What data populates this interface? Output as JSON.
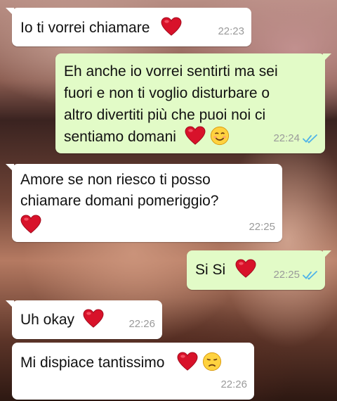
{
  "messages": [
    {
      "direction": "incoming",
      "text": "Io ti vorrei chiamare",
      "time": "22:23",
      "emojis": [
        "heart-icon"
      ]
    },
    {
      "direction": "outgoing",
      "lines": [
        "Eh anche io vorrei sentirti ma sei",
        "fuori e non ti voglio disturbare o",
        "altro divertiti più che puoi noi ci",
        "sentiamo domani"
      ],
      "time": "22:24",
      "read": true,
      "emojis": [
        "heart-icon",
        "smiling-face-icon"
      ]
    },
    {
      "direction": "incoming",
      "lines": [
        "Amore se non riesco ti posso",
        "chiamare domani pomeriggio?"
      ],
      "time": "22:25",
      "emojis": [
        "heart-icon"
      ]
    },
    {
      "direction": "outgoing",
      "text": "Si Si",
      "time": "22:25",
      "read": true,
      "emojis": [
        "heart-icon"
      ]
    },
    {
      "direction": "incoming",
      "text": "Uh okay",
      "time": "22:26",
      "emojis": [
        "heart-icon"
      ]
    },
    {
      "direction": "incoming",
      "text": "Mi dispiace tantissimo",
      "time": "22:26",
      "emojis": [
        "heart-icon",
        "disappointed-face-icon"
      ]
    }
  ],
  "colors": {
    "incoming_bubble": "#ffffff",
    "outgoing_bubble": "#e2fbc7",
    "read_ticks": "#4fb3e8",
    "heart": "#d8122a",
    "timestamp": "#9a9a9a"
  }
}
